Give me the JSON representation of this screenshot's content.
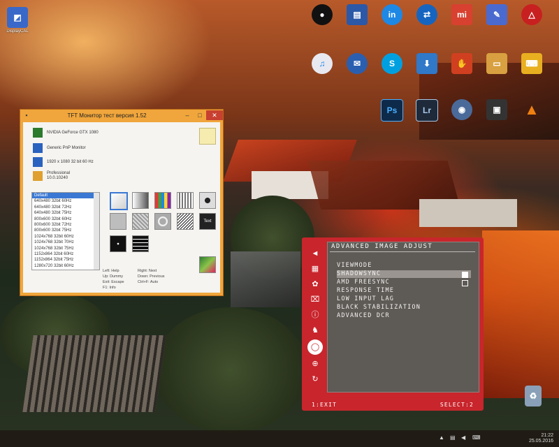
{
  "desktop_icons": [
    {
      "label": "DisplayCAL",
      "glyph": "◩",
      "color": "#3a68c8",
      "icon": "displaycal-icon"
    },
    {
      "label": "",
      "glyph": "●",
      "color": "#111111",
      "icon": "black-circle-app-icon"
    },
    {
      "label": "",
      "glyph": "▤",
      "color": "#2c58a8",
      "icon": "app-window-icon"
    },
    {
      "label": "",
      "glyph": "in",
      "color": "#1e88e5",
      "icon": "blue-round-app-icon"
    },
    {
      "label": "",
      "glyph": "⇄",
      "color": "#1565c0",
      "icon": "teamviewer-icon"
    },
    {
      "label": "",
      "glyph": "mi",
      "color": "#d84030",
      "icon": "mi-app-icon"
    },
    {
      "label": "",
      "glyph": "✎",
      "color": "#4a6ad0",
      "icon": "pen-app-icon"
    },
    {
      "label": "",
      "glyph": "△",
      "color": "#c82020",
      "icon": "triangle-app-icon"
    },
    {
      "label": "iTunes",
      "glyph": "♫",
      "color": "#e8e8f0",
      "icon": "itunes-icon"
    },
    {
      "label": "Thunderbird",
      "glyph": "✉",
      "color": "#2a5fb0",
      "icon": "thunderbird-icon"
    },
    {
      "label": "Skype",
      "glyph": "S",
      "color": "#00a0e0",
      "icon": "skype-icon"
    },
    {
      "label": "",
      "glyph": "⬇",
      "color": "#3078c8",
      "icon": "download-master-icon"
    },
    {
      "label": "",
      "glyph": "✋",
      "color": "#d04020",
      "icon": "hand-app-icon"
    },
    {
      "label": "",
      "glyph": "▭",
      "color": "#d8a040",
      "icon": "folder-icon"
    },
    {
      "label": "",
      "glyph": "⌨",
      "color": "#e8b020",
      "icon": "keyboard-app-icon"
    },
    {
      "label": "Photoshop",
      "glyph": "Ps",
      "color": "#0e2a4a",
      "icon": "photoshop-icon"
    },
    {
      "label": "Lightroom",
      "glyph": "Lr",
      "color": "#1e2a3a",
      "icon": "lightroom-icon"
    },
    {
      "label": "",
      "glyph": "◉",
      "color": "#4a6a9a",
      "icon": "eye-viewer-icon"
    },
    {
      "label": "",
      "glyph": "▣",
      "color": "#333333",
      "icon": "media-app-icon"
    },
    {
      "label": "VLC",
      "glyph": "▲",
      "color": "#f08010",
      "icon": "vlc-icon"
    },
    {
      "label": "",
      "glyph": "♻",
      "color": "#8aa0b8",
      "icon": "recycle-bin-icon"
    }
  ],
  "window": {
    "title": "TFT Монитор тест версия 1.52",
    "minimize": "–",
    "maximize": "□",
    "close": "✕",
    "info_rows": [
      {
        "text": "NVIDIA GeForce GTX 1080",
        "icon": "gpu-icon",
        "color": "#2c7a2c"
      },
      {
        "text": "Generic PnP Monitor",
        "icon": "monitor-icon",
        "color": "#2a62c0"
      },
      {
        "text": "1920 x 1080 32 bit 60 Hz",
        "icon": "resolution-icon",
        "color": "#2a62c0"
      },
      {
        "text": "Professional 10.0.10240",
        "icon": "os-icon",
        "color": "#e0a030"
      }
    ],
    "modes": [
      "Default",
      "640x480 32bit 60Hz",
      "640x480 32bit 72Hz",
      "640x480 32bit 75Hz",
      "800x600 32bit 60Hz",
      "800x600 32bit 72Hz",
      "800x600 32bit 75Hz",
      "1024x768 32bit 60Hz",
      "1024x768 32bit 70Hz",
      "1024x768 32bit 75Hz",
      "1152x864 32bit 60Hz",
      "1152x864 32bit 75Hz",
      "1280x720 32bit 60Hz"
    ],
    "tiles": [
      {
        "icon": "gradient-test-icon",
        "bg": "linear-gradient(135deg,#ffffff,#cfcfcf)"
      },
      {
        "icon": "grey-gradient-test-icon",
        "bg": "linear-gradient(90deg,#ffffff,#555555)"
      },
      {
        "icon": "color-bars-test-icon",
        "bg": "linear-gradient(90deg,#e53935 0 20%,#43a047 20% 40%,#1e88e5 40% 60%,#fdd835 60% 80%,#8e24aa 80%)"
      },
      {
        "icon": "stripe-test-icon",
        "bg": "repeating-linear-gradient(90deg,#ffffff 0 2px,#777777 2px 4px)"
      },
      {
        "icon": "radial-test-icon",
        "bg": "radial-gradient(circle,#222 0 25%,#dddddd 26% 100%)"
      },
      {
        "icon": "grey-field-test-icon",
        "bg": "#bdbdbd"
      },
      {
        "icon": "noise-test-icon",
        "bg": "repeating-linear-gradient(45deg,#d8d8d8 0 2px,#9a9a9a 2px 4px)"
      },
      {
        "icon": "circle-target-test-icon",
        "bg": "radial-gradient(circle,#aaaaaa 0 30%,#eeeeee 31% 45%,#aaaaaa 46%)"
      },
      {
        "icon": "moire-test-icon",
        "bg": "repeating-linear-gradient(135deg,#222 0 1px,#ffffff 1px 3px)"
      },
      {
        "icon": "text-test-icon",
        "bg": "#222222",
        "label": "Text"
      },
      {
        "icon": "black-pixel-test-icon",
        "bg": "radial-gradient(circle,#ffffff 0 8%,#111111 9%)"
      },
      {
        "icon": "lines-test-icon",
        "bg": "repeating-linear-gradient(180deg,#111 0 4px,#ffffff 4px 5px)"
      },
      {
        "icon": "color-picture-test-icon",
        "bg": "linear-gradient(135deg,#2e7d32,#8bc34a 50%,#e91e63)"
      }
    ],
    "legend": [
      [
        "Left: Help",
        "Right: Next"
      ],
      [
        "Up: Dummy",
        "Down: Previous"
      ],
      [
        "Exit: Escape",
        "Ctrl+F: Auto"
      ],
      [
        "F1: Info",
        ""
      ]
    ]
  },
  "osd": {
    "title": "ADVANCED IMAGE ADJUST",
    "items": [
      {
        "label": "VIEWMODE",
        "highlighted": false,
        "checkbox": false
      },
      {
        "label": "SHADOWSYNC",
        "highlighted": true,
        "checkbox": true,
        "checked": true
      },
      {
        "label": "AMD FREESYNC",
        "highlighted": false,
        "checkbox": true,
        "checked": false
      },
      {
        "label": "RESPONSE TIME",
        "highlighted": false,
        "checkbox": false
      },
      {
        "label": "LOW INPUT LAG",
        "highlighted": false,
        "checkbox": false
      },
      {
        "label": "BLACK STABILIZATION",
        "highlighted": false,
        "checkbox": false
      },
      {
        "label": "ADVANCED DCR",
        "highlighted": false,
        "checkbox": false
      }
    ],
    "rail_icons": [
      {
        "glyph": "◄",
        "icon": "back-arrow-icon"
      },
      {
        "glyph": "▦",
        "icon": "image-setup-icon"
      },
      {
        "glyph": "✿",
        "icon": "color-adjust-icon"
      },
      {
        "glyph": "⌧",
        "icon": "input-icon"
      },
      {
        "glyph": "ⓘ",
        "icon": "information-icon"
      },
      {
        "glyph": "♞",
        "icon": "game-mode-icon"
      },
      {
        "glyph": "◯",
        "icon": "advanced-image-icon",
        "selected": true
      },
      {
        "glyph": "⊕",
        "icon": "setup-menu-icon"
      },
      {
        "glyph": "↻",
        "icon": "reset-icon"
      }
    ],
    "exit_hint": "1:EXIT",
    "select_hint": "SELECT:2",
    "colors": {
      "frame": "#c8252c",
      "panel": "#5e5a55"
    }
  },
  "taskbar": {
    "time": "21:22",
    "date": "25.05.2016"
  }
}
